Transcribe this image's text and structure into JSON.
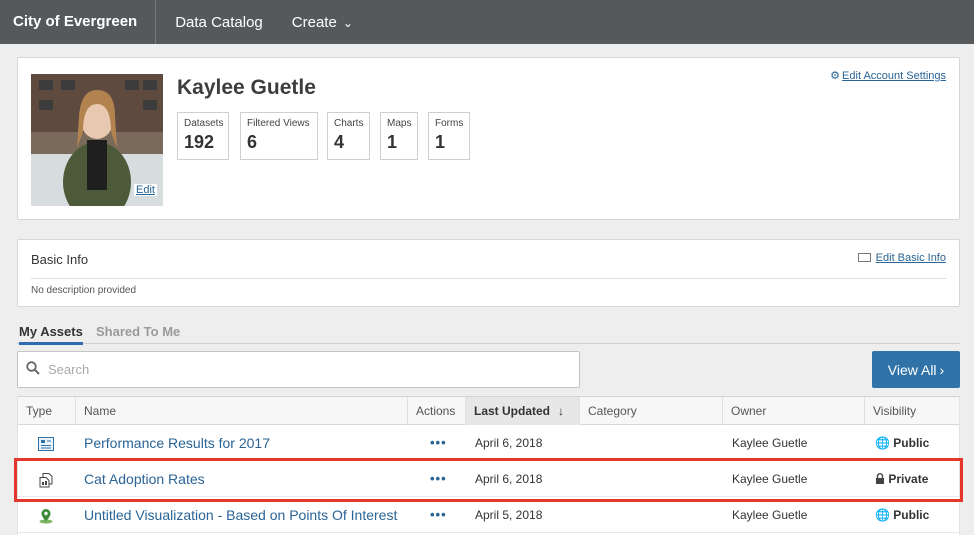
{
  "topnav": {
    "brand": "City of Evergreen",
    "links": [
      "Data Catalog",
      "Create"
    ]
  },
  "profile": {
    "name": "Kaylee Guetle",
    "photo_edit": "Edit",
    "edit_account_settings": "Edit Account Settings",
    "stats": [
      {
        "label": "Datasets",
        "value": "192"
      },
      {
        "label": "Filtered Views",
        "value": "6"
      },
      {
        "label": "Charts",
        "value": "4"
      },
      {
        "label": "Maps",
        "value": "1"
      },
      {
        "label": "Forms",
        "value": "1"
      }
    ]
  },
  "basic_info": {
    "title": "Basic Info",
    "edit_label": "Edit Basic Info",
    "description": "No description provided"
  },
  "tabs": {
    "my_assets": "My Assets",
    "shared": "Shared To Me"
  },
  "search": {
    "placeholder": "Search",
    "view_all": "View All"
  },
  "table": {
    "headers": [
      "Type",
      "Name",
      "Actions",
      "Last Updated",
      "Category",
      "Owner",
      "Visibility"
    ],
    "rows": [
      {
        "type_icon": "dataset-icon",
        "name": "Performance Results for 2017",
        "actions": "•••",
        "updated": "April 6, 2018",
        "category": "",
        "owner": "Kaylee Guetle",
        "visibility": "Public",
        "visibility_icon": "globe-icon"
      },
      {
        "type_icon": "filtered-view-icon",
        "name": "Cat Adoption Rates",
        "actions": "•••",
        "updated": "April 6, 2018",
        "category": "",
        "owner": "Kaylee Guetle",
        "visibility": "Private",
        "visibility_icon": "lock-icon"
      },
      {
        "type_icon": "map-pin-icon",
        "name": "Untitled Visualization - Based on Points Of Interest",
        "actions": "•••",
        "updated": "April 5, 2018",
        "category": "",
        "owner": "Kaylee Guetle",
        "visibility": "Public",
        "visibility_icon": "globe-icon"
      }
    ]
  },
  "colors": {
    "nav_bg": "#56595c",
    "accent": "#2f73a8",
    "link": "#2a6496",
    "highlight": "#e5362b"
  }
}
